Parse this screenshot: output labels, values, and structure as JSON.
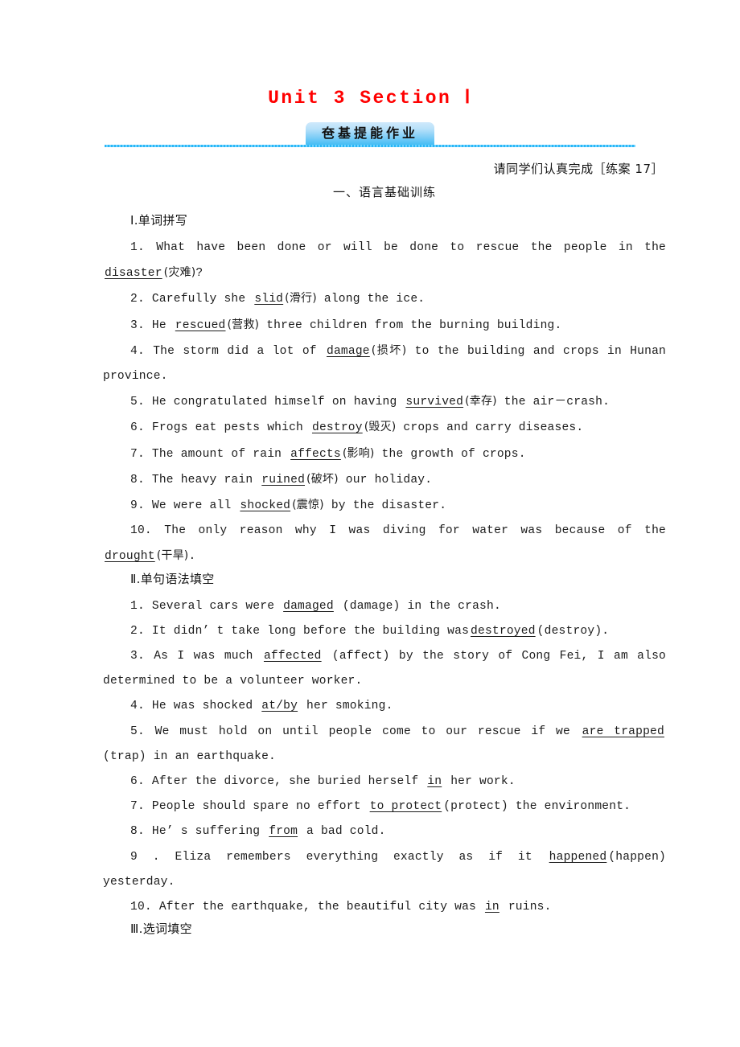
{
  "document": {
    "title": "Unit 3  Section Ⅰ",
    "badge_label": "夿基提能作业",
    "instruction": "请同学们认真完成［练案 17］",
    "accent_red": "#ff0000",
    "accent_blue": "#29b6f6",
    "badge_gradient_from": "#cfe9fb",
    "badge_gradient_to": "#46bcf3"
  },
  "part_one": {
    "heading": "一、语言基础训练",
    "section_1": {
      "heading": "Ⅰ.单词拼写",
      "items": [
        {
          "num": "1.",
          "before": "What have been done or will be done to rescue the people in the",
          "answer": "disaster",
          "hint": "(灾难)",
          "after": "?"
        },
        {
          "num": "2.",
          "before": "Carefully she",
          "answer": "slid",
          "hint": "(滑行)",
          "after": "along the ice."
        },
        {
          "num": "3.",
          "before": "He",
          "answer": "rescued",
          "hint": "(营救)",
          "after": "three children from the burning building."
        },
        {
          "num": "4.",
          "before": "The storm did a lot of",
          "answer": "damage",
          "hint": "(损坏)",
          "after": "to the building and crops in Hunan province."
        },
        {
          "num": "5.",
          "before": "He congratulated himself on having",
          "answer": "survived",
          "hint": "(幸存)",
          "after": "the air－crash."
        },
        {
          "num": "6.",
          "before": "Frogs eat pests which",
          "answer": "destroy",
          "hint": "(毁灭)",
          "after": "crops and carry diseases."
        },
        {
          "num": "7.",
          "before": "The amount of rain",
          "answer": "affects",
          "hint": "(影响)",
          "after": "the growth of crops."
        },
        {
          "num": "8.",
          "before": "The heavy rain",
          "answer": "ruined",
          "hint": "(破坏)",
          "after": "our holiday."
        },
        {
          "num": "9.",
          "before": "We were all",
          "answer": "shocked",
          "hint": "(震惊)",
          "after": "by the disaster."
        },
        {
          "num": "10.",
          "before": "The only reason why I was diving for water was because of the",
          "answer": "drought",
          "hint": "(干旱)",
          "after": "."
        }
      ]
    },
    "section_2": {
      "heading": "Ⅱ.单句语法填空",
      "items": [
        {
          "num": "1.",
          "before": "Several cars were",
          "answer": "damaged",
          "hint": "(damage)",
          "after": "in the crash."
        },
        {
          "num": "2.",
          "before": "It didn’ t take long before the building was",
          "answer": "destroyed",
          "hint": "(destroy)",
          "after": "."
        },
        {
          "num": "3.",
          "before": "As I was much",
          "answer": "affected",
          "hint": "(affect)",
          "after": "by the story of Cong Fei, I am also determined to be a volunteer worker."
        },
        {
          "num": "4.",
          "before": "He was shocked",
          "answer": "at/by",
          "hint": "",
          "after": "her smoking."
        },
        {
          "num": "5.",
          "before": "We must hold on until people come to our rescue if we",
          "answer": "are trapped",
          "hint": "(trap)",
          "after": "in an earthquake."
        },
        {
          "num": "6.",
          "before": "After the divorce, she buried herself",
          "answer": "in",
          "hint": "",
          "after": "her work."
        },
        {
          "num": "7.",
          "before": "People should spare no effort",
          "answer": "to protect",
          "hint": "(protect)",
          "after": "the environment."
        },
        {
          "num": "8.",
          "before": "He’ s suffering",
          "answer": "from",
          "hint": "",
          "after": "a bad cold."
        },
        {
          "num": "9 .",
          "before": "Eliza remembers everything exactly as if it",
          "answer": "happened",
          "hint": "(happen)",
          "after": "yesterday."
        },
        {
          "num": "10.",
          "before": "After the earthquake, the beautiful city was",
          "answer": "in",
          "hint": "",
          "after": "ruins."
        }
      ]
    },
    "section_3": {
      "heading": "Ⅲ.选词填空"
    }
  }
}
